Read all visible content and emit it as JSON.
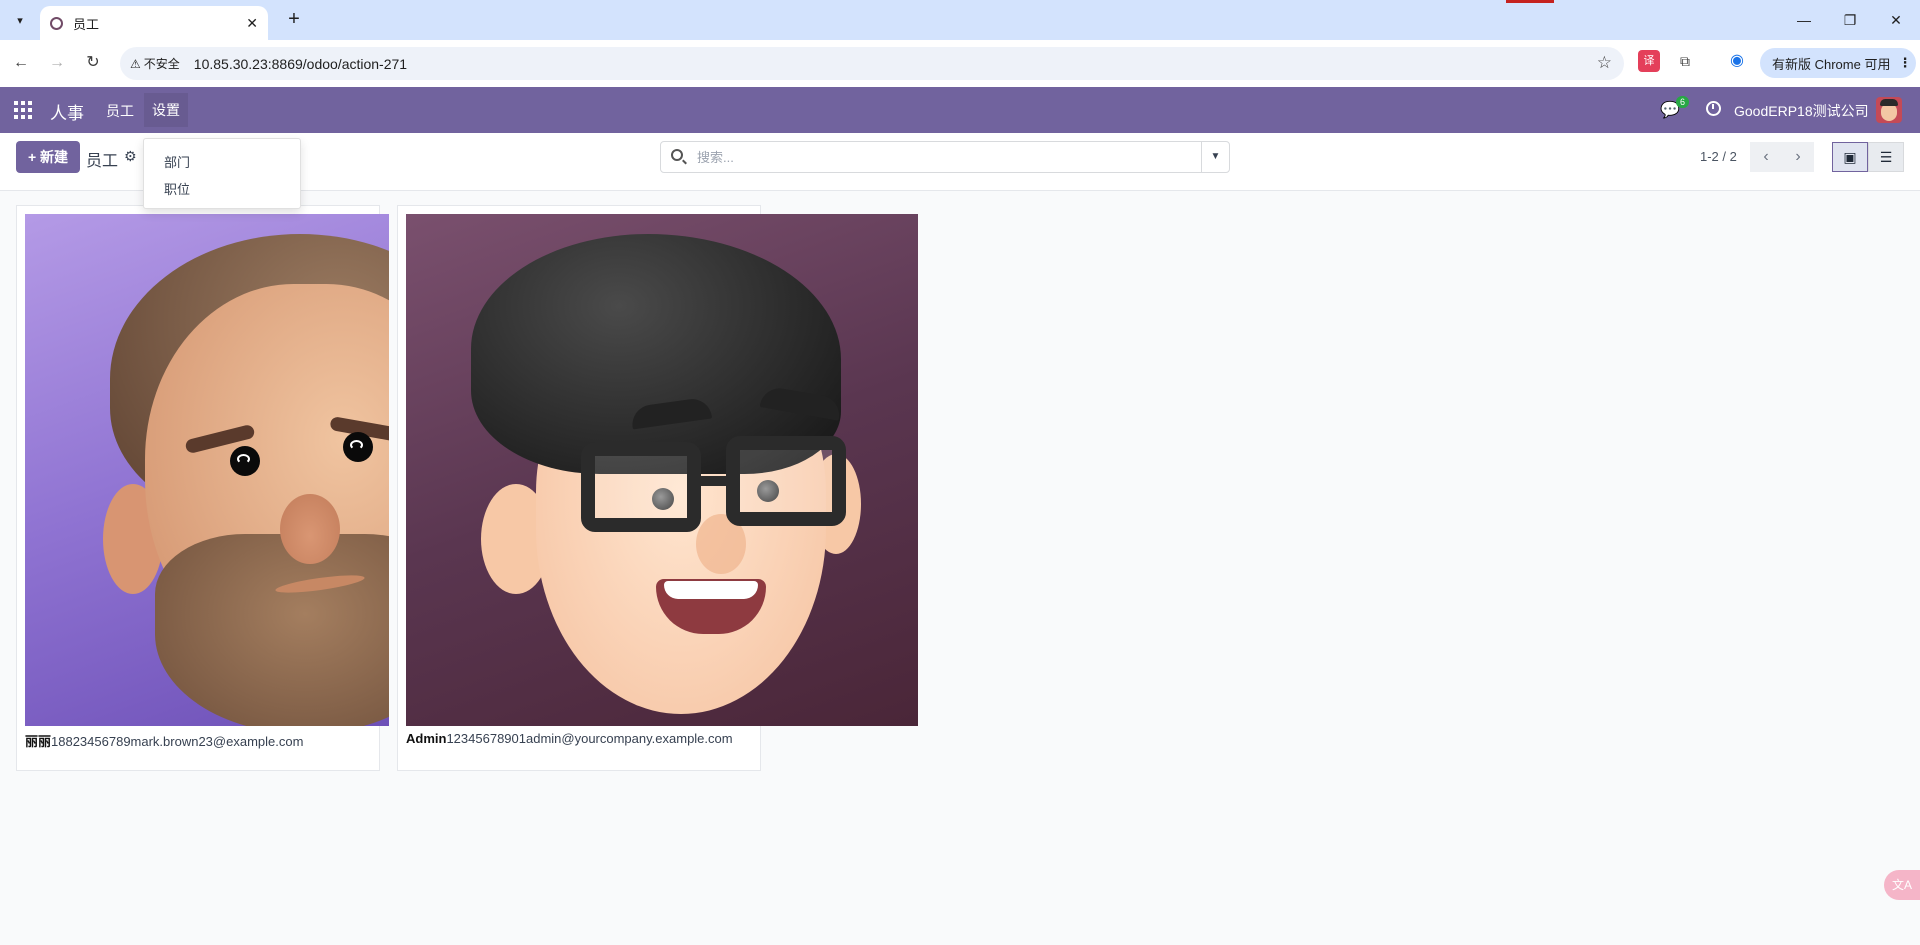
{
  "browser": {
    "tab_title": "员工",
    "tab_close": "✕",
    "new_tab": "+",
    "security_label": "不安全",
    "url": "10.85.30.23:8869/odoo/action-271",
    "update_label": "有新版 Chrome 可用",
    "icons": [
      "tab-search-icon",
      "back-icon",
      "forward-icon",
      "reload-icon",
      "warning-icon",
      "star-icon",
      "translate-extension-icon",
      "extensions-icon",
      "profile-icon",
      "kebab-icon",
      "minimize-icon",
      "restore-icon",
      "close-icon"
    ]
  },
  "navbar": {
    "app_name": "人事",
    "menu": [
      "员工",
      "设置"
    ],
    "active_menu": "设置",
    "chat_badge": "6",
    "company": "GoodERP18测试公司",
    "color": "#71639e"
  },
  "control_panel": {
    "new_button": "新建",
    "breadcrumb": "员工",
    "search_placeholder": "搜索...",
    "pager": "1-2 / 2"
  },
  "settings_dropdown": {
    "items": [
      "部门",
      "职位"
    ]
  },
  "employees": [
    {
      "name": "丽丽",
      "phone": "18823456789",
      "email": "mark.brown23@example.com"
    },
    {
      "name": "Admin",
      "phone": "12345678901",
      "email": "admin@yourcompany.example.com"
    }
  ],
  "floating_widget": "文A"
}
